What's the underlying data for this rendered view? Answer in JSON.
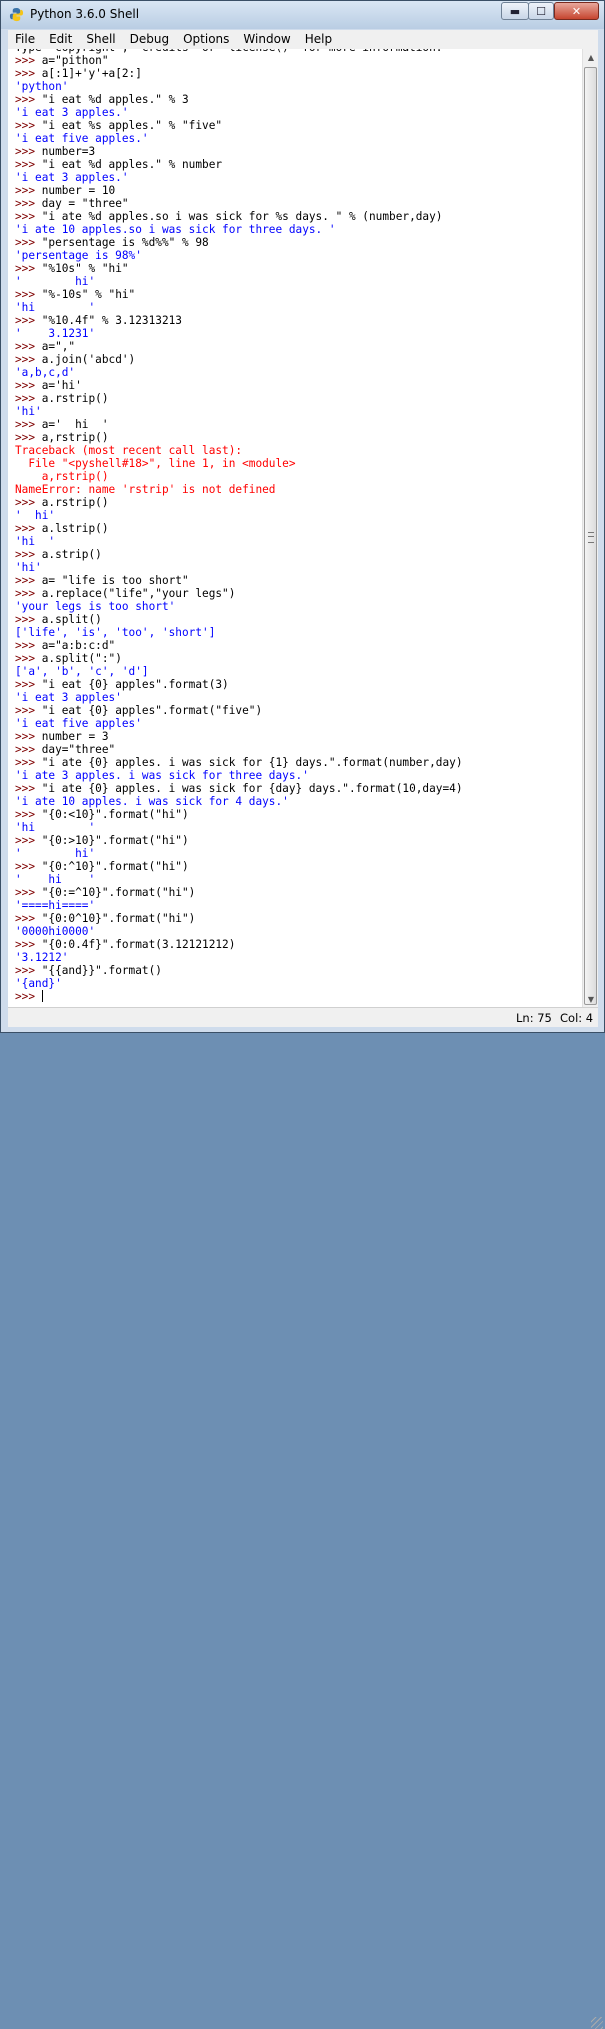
{
  "window": {
    "title": "Python 3.6.0 Shell",
    "controls": {
      "minimize": "▬",
      "maximize": "☐",
      "close": "✕"
    }
  },
  "menu": [
    "File",
    "Edit",
    "Shell",
    "Debug",
    "Options",
    "Window",
    "Help"
  ],
  "colors": {
    "prompt": "#7f0000",
    "output": "#0000ff",
    "error": "#ff0000",
    "string": "#00aa00"
  },
  "shell": {
    "lines": [
      {
        "cls": "code",
        "text": "Type \"copyright\", \"credits\" or \"license()\" for more information."
      },
      {
        "cls": "code",
        "text": ">>> a=\"pithon\""
      },
      {
        "cls": "code",
        "text": ">>> a[:1]+'y'+a[2:]"
      },
      {
        "cls": "out",
        "text": "'python'"
      },
      {
        "cls": "code",
        "text": ">>> \"i eat %d apples.\" % 3"
      },
      {
        "cls": "out",
        "text": "'i eat 3 apples.'"
      },
      {
        "cls": "code",
        "text": ">>> \"i eat %s apples.\" % \"five\""
      },
      {
        "cls": "out",
        "text": "'i eat five apples.'"
      },
      {
        "cls": "code",
        "text": ">>> number=3"
      },
      {
        "cls": "code",
        "text": ">>> \"i eat %d apples.\" % number"
      },
      {
        "cls": "out",
        "text": "'i eat 3 apples.'"
      },
      {
        "cls": "code",
        "text": ">>> number = 10"
      },
      {
        "cls": "code",
        "text": ">>> day = \"three\""
      },
      {
        "cls": "code",
        "text": ">>> \"i ate %d apples.so i was sick for %s days. \" % (number,day)"
      },
      {
        "cls": "out",
        "text": "'i ate 10 apples.so i was sick for three days. '"
      },
      {
        "cls": "code",
        "text": ">>> \"persentage is %d%%\" % 98"
      },
      {
        "cls": "out",
        "text": "'persentage is 98%'"
      },
      {
        "cls": "code",
        "text": ">>> \"%10s\" % \"hi\""
      },
      {
        "cls": "out",
        "text": "'        hi'"
      },
      {
        "cls": "code",
        "text": ">>> \"%-10s\" % \"hi\""
      },
      {
        "cls": "out",
        "text": "'hi        '"
      },
      {
        "cls": "code",
        "text": ">>> \"%10.4f\" % 3.12313213"
      },
      {
        "cls": "out",
        "text": "'    3.1231'"
      },
      {
        "cls": "code",
        "text": ">>> a=\",\""
      },
      {
        "cls": "code",
        "text": ">>> a.join('abcd')"
      },
      {
        "cls": "out",
        "text": "'a,b,c,d'"
      },
      {
        "cls": "code",
        "text": ">>> a='hi'"
      },
      {
        "cls": "code",
        "text": ">>> a.rstrip()"
      },
      {
        "cls": "out",
        "text": "'hi'"
      },
      {
        "cls": "code",
        "text": ">>> a='  hi  '"
      },
      {
        "cls": "code",
        "text": ">>> a,rstrip()"
      },
      {
        "cls": "err",
        "text": "Traceback (most recent call last):"
      },
      {
        "cls": "err",
        "text": "  File \"<pyshell#18>\", line 1, in <module>"
      },
      {
        "cls": "err",
        "text": "    a,rstrip()"
      },
      {
        "cls": "err",
        "text": "NameError: name 'rstrip' is not defined"
      },
      {
        "cls": "code",
        "text": ">>> a.rstrip()"
      },
      {
        "cls": "out",
        "text": "'  hi'"
      },
      {
        "cls": "code",
        "text": ">>> a.lstrip()"
      },
      {
        "cls": "out",
        "text": "'hi  '"
      },
      {
        "cls": "code",
        "text": ">>> a.strip()"
      },
      {
        "cls": "out",
        "text": "'hi'"
      },
      {
        "cls": "code",
        "text": ">>> a= \"life is too short\""
      },
      {
        "cls": "code",
        "text": ">>> a.replace(\"life\",\"your legs\")"
      },
      {
        "cls": "out",
        "text": "'your legs is too short'"
      },
      {
        "cls": "code",
        "text": ">>> a.split()"
      },
      {
        "cls": "out",
        "text": "['life', 'is', 'too', 'short']"
      },
      {
        "cls": "code",
        "text": ">>> a=\"a:b:c:d\""
      },
      {
        "cls": "code",
        "text": ">>> a.split(\":\")"
      },
      {
        "cls": "out",
        "text": "['a', 'b', 'c', 'd']"
      },
      {
        "cls": "code",
        "text": ">>> \"i eat {0} apples\".format(3)"
      },
      {
        "cls": "out",
        "text": "'i eat 3 apples'"
      },
      {
        "cls": "code",
        "text": ">>> \"i eat {0} apples\".format(\"five\")"
      },
      {
        "cls": "out",
        "text": "'i eat five apples'"
      },
      {
        "cls": "code",
        "text": ">>> number = 3"
      },
      {
        "cls": "code",
        "text": ">>> day=\"three\""
      },
      {
        "cls": "code",
        "text": ">>> \"i ate {0} apples. i was sick for {1} days.\".format(number,day)"
      },
      {
        "cls": "out",
        "text": "'i ate 3 apples. i was sick for three days.'"
      },
      {
        "cls": "code",
        "text": ">>> \"i ate {0} apples. i was sick for {day} days.\".format(10,day=4)"
      },
      {
        "cls": "out",
        "text": "'i ate 10 apples. i was sick for 4 days.'"
      },
      {
        "cls": "code",
        "text": ">>> \"{0:<10}\".format(\"hi\")"
      },
      {
        "cls": "out",
        "text": "'hi        '"
      },
      {
        "cls": "code",
        "text": ">>> \"{0:>10}\".format(\"hi\")"
      },
      {
        "cls": "out",
        "text": "'        hi'"
      },
      {
        "cls": "code",
        "text": ">>> \"{0:^10}\".format(\"hi\")"
      },
      {
        "cls": "out",
        "text": "'    hi    '"
      },
      {
        "cls": "code",
        "text": ">>> \"{0:=^10}\".format(\"hi\")"
      },
      {
        "cls": "out",
        "text": "'====hi===='"
      },
      {
        "cls": "code",
        "text": ">>> \"{0:0^10}\".format(\"hi\")"
      },
      {
        "cls": "out",
        "text": "'0000hi0000'"
      },
      {
        "cls": "code",
        "text": ">>> \"{0:0.4f}\".format(3.12121212)"
      },
      {
        "cls": "out",
        "text": "'3.1212'"
      },
      {
        "cls": "code",
        "text": ">>> \"{{and}}\".format()"
      },
      {
        "cls": "out",
        "text": "'{and}'"
      }
    ],
    "current_prompt": ">>> "
  },
  "status": {
    "line": "Ln: 75",
    "col": "Col: 4"
  }
}
